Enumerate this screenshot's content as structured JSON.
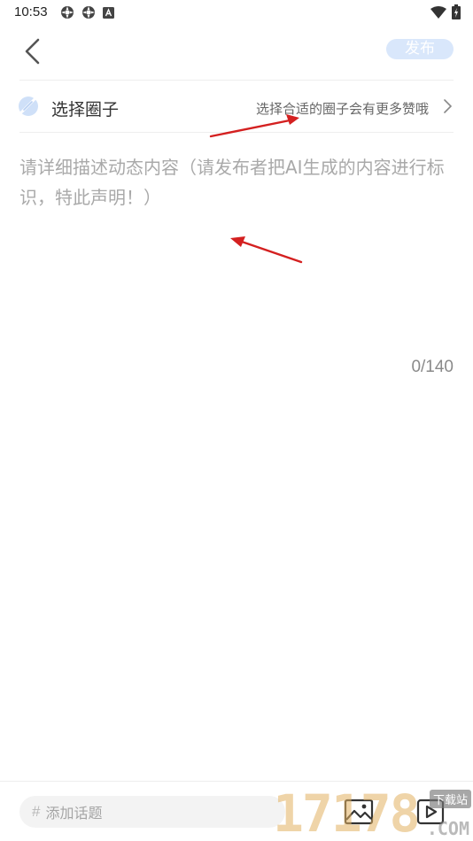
{
  "status_bar": {
    "time": "10:53",
    "left_icons": [
      "notification-icon",
      "notification-icon",
      "app-icon"
    ],
    "right_icons": [
      "wifi-icon",
      "battery-icon"
    ]
  },
  "header": {
    "back_icon": "chevron-left-icon",
    "publish_label": "发布"
  },
  "circle_selector": {
    "label": "选择圈子",
    "hint": "选择合适的圈子会有更多赞哦",
    "icon": "circle-icon"
  },
  "description": {
    "placeholder": "请详细描述动态内容（请发布者把AI生成的内容进行标识，特此声明！）",
    "value": "",
    "counter": "0/140"
  },
  "bottom_bar": {
    "topic_hash": "#",
    "topic_placeholder": "添加话题",
    "image_icon": "image-icon",
    "video_icon": "video-icon"
  },
  "watermark": {
    "digits": "17178",
    "site": "下载站",
    "domain": ".COM"
  },
  "colors": {
    "publish_bg": "#d9e7fb",
    "placeholder": "#a9a9a9",
    "annotation_arrow": "#d42020"
  }
}
